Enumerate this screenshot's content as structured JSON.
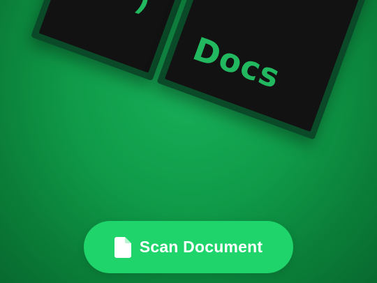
{
  "hero": {
    "left_tile_label": ")",
    "right_tile_label": "Docs"
  },
  "actions": {
    "scan_button_label": "Scan Document",
    "scan_icon": "document-icon"
  },
  "colors": {
    "background": "#0f9a48",
    "button": "#1fd46a",
    "tile_text": "#22b85f",
    "tile_face": "#121212"
  }
}
